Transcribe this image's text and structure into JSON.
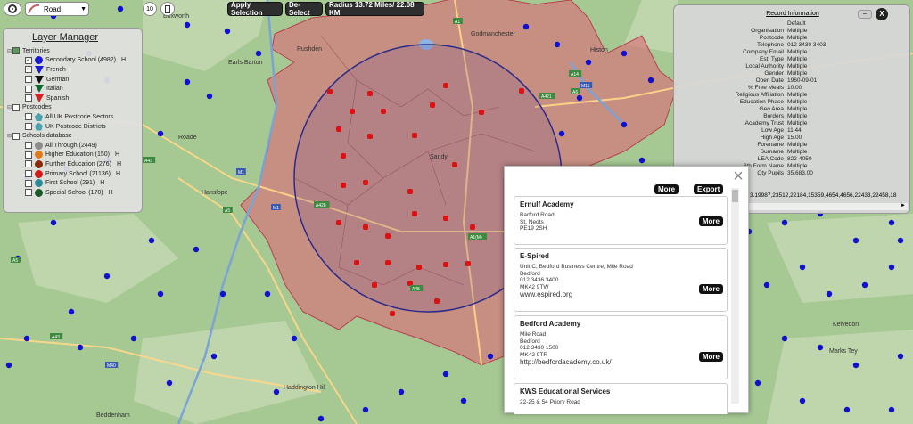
{
  "toolbar": {
    "map_type": "Road",
    "zoom_level": "10",
    "apply_selection": "Apply Selection",
    "de_select": "De-Select",
    "radius": "Radius 13.72 Miles/ 22.08 KM"
  },
  "map": {
    "place_labels": [
      "Brixworth",
      "Rushden",
      "Earls Barton",
      "Godmanchester",
      "Histon",
      "Hanslope",
      "Roade",
      "Sandy",
      "Haddington Hill",
      "Kelvedon",
      "Marks Tey",
      "Beddenham"
    ],
    "road_labels": [
      "M1",
      "M1",
      "A1",
      "A14",
      "A428",
      "A421",
      "A6",
      "A5",
      "A1(M)",
      "M11",
      "M40",
      "A43",
      "A45",
      "A43",
      "A5"
    ]
  },
  "layer_manager": {
    "title": "Layer Manager",
    "groups": [
      {
        "label": "Territories",
        "items": [
          {
            "label": "Secondary School (4982)",
            "h": "H",
            "color": "#1a1ad6",
            "shape": "circle",
            "checked": true
          },
          {
            "label": "French",
            "h": "",
            "color": "#1a1ad6",
            "shape": "tri",
            "checked": true
          },
          {
            "label": "German",
            "h": "",
            "color": "#111111",
            "shape": "tri",
            "checked": false
          },
          {
            "label": "Italian",
            "h": "",
            "color": "#0a6a2a",
            "shape": "tri",
            "checked": false
          },
          {
            "label": "Spanish",
            "h": "",
            "color": "#d62020",
            "shape": "tri",
            "checked": false
          }
        ]
      },
      {
        "label": "Postcodes",
        "items": [
          {
            "label": "All UK Postcode Sectors",
            "h": "",
            "color": "#4aa4b0",
            "shape": "pent",
            "checked": false
          },
          {
            "label": "UK Postcode Districts",
            "h": "",
            "color": "#4aa4b0",
            "shape": "pent",
            "checked": false
          }
        ]
      },
      {
        "label": "Schools database",
        "items": [
          {
            "label": "All Through (2449)",
            "h": "",
            "color": "#8c8c8c",
            "shape": "circle",
            "checked": false
          },
          {
            "label": "Higher Education (150)",
            "h": "H",
            "color": "#e07a1a",
            "shape": "circle",
            "checked": false
          },
          {
            "label": "Further Education (276)",
            "h": "H",
            "color": "#8a2a0a",
            "shape": "circle",
            "checked": false
          },
          {
            "label": "Primary School (21136)",
            "h": "H",
            "color": "#d61a1a",
            "shape": "circle",
            "checked": false
          },
          {
            "label": "First School (291)",
            "h": "H",
            "color": "#2a8a9a",
            "shape": "circle",
            "checked": false
          },
          {
            "label": "Special School (170)",
            "h": "H",
            "color": "#1a5a2a",
            "shape": "circle",
            "checked": false
          }
        ]
      }
    ]
  },
  "record_info": {
    "title": "Record Information",
    "close_label": "X",
    "rows": [
      {
        "k": "",
        "v": "Default"
      },
      {
        "k": "Organisation",
        "v": "Multiple"
      },
      {
        "k": "Postcode",
        "v": "Multiple"
      },
      {
        "k": "Telephone",
        "v": "012 3430 3403"
      },
      {
        "k": "Company Email",
        "v": "Multiple"
      },
      {
        "k": "Est. Type",
        "v": "Multiple"
      },
      {
        "k": "Local Authority",
        "v": "Multiple"
      },
      {
        "k": "Gender",
        "v": "Multiple"
      },
      {
        "k": "Open Date",
        "v": "1960-09-01"
      },
      {
        "k": "% Free Meals",
        "v": "10.00"
      },
      {
        "k": "Religious Affiliation",
        "v": "Multiple"
      },
      {
        "k": "Education Phase",
        "v": "Multiple"
      },
      {
        "k": "Geo Area",
        "v": "Multiple"
      },
      {
        "k": "Borders",
        "v": "Multiple"
      },
      {
        "k": "Academy Trust",
        "v": "Multiple"
      },
      {
        "k": "Low Age",
        "v": "11.44"
      },
      {
        "k": "High Age",
        "v": "15.00"
      },
      {
        "k": "Forename",
        "v": "Multiple"
      },
      {
        "k": "Surname",
        "v": "Multiple"
      },
      {
        "k": "LEA Code",
        "v": "822-4050"
      },
      {
        "k": "6th Form Name",
        "v": "Multiple"
      },
      {
        "k": "Qty Pupils",
        "v": "35,683.00"
      }
    ],
    "id_list": "3.19987,23512,22184,15359,4654,4656,22433,22458,18"
  },
  "results": {
    "more_label": "More",
    "export_label": "Export",
    "close_label": "×",
    "cards": [
      {
        "name": "Ernulf Academy",
        "lines": [
          "Barford Road",
          "St. Neots",
          "PE19 2SH"
        ],
        "url": ""
      },
      {
        "name": "E-Spired",
        "lines": [
          "Unit C, Bedford Business Centre, Mile Road",
          "Bedford",
          "012 3436 3400",
          "MK42 9TW"
        ],
        "url": "www.espired.org"
      },
      {
        "name": "Bedford Academy",
        "lines": [
          "Mile Road",
          "Bedford",
          "012 3430 1500",
          "MK42 9TR"
        ],
        "url": "http://bedfordacademy.co.uk/"
      },
      {
        "name": "KWS Educational Services",
        "lines": [
          "22-25 & 54 Priory Road"
        ],
        "url": ""
      }
    ]
  },
  "colors": {
    "territory": "#d9707a",
    "marker_blue": "#1010d0",
    "marker_red": "#dd1111",
    "radius_circle": "#2a2a8a"
  }
}
